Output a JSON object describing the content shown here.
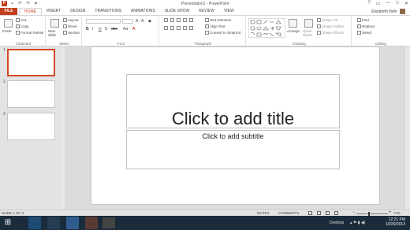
{
  "window": {
    "title": "Presentation1 - PowerPoint",
    "controls": [
      "?",
      "▭",
      "—",
      "□",
      "✕"
    ]
  },
  "qat": {
    "app": "P",
    "save": "▪",
    "undo": "↶",
    "redo": "↷",
    "more": "▾"
  },
  "tabs": {
    "file": "FILE",
    "items": [
      "HOME",
      "INSERT",
      "DESIGN",
      "TRANSITIONS",
      "ANIMATIONS",
      "SLIDE SHOW",
      "REVIEW",
      "VIEW"
    ],
    "active": "HOME"
  },
  "user": {
    "name": "Elizabeth Nohr"
  },
  "ribbon": {
    "clipboard": {
      "label": "Clipboard",
      "paste": "Paste",
      "cut": "Cut",
      "copy": "Copy",
      "format_painter": "Format Painter"
    },
    "slides": {
      "label": "Slides",
      "new_slide": "New Slide",
      "layout": "Layout",
      "reset": "Reset",
      "section": "Section"
    },
    "font": {
      "label": "Font",
      "bold": "B",
      "italic": "I",
      "underline": "U",
      "shadow": "S",
      "strike": "abc",
      "case": "Aa",
      "color": "A"
    },
    "paragraph": {
      "label": "Paragraph",
      "text_direction": "Text Direction",
      "align_text": "Align Text",
      "smartart": "Convert to SmartArt"
    },
    "drawing": {
      "label": "Drawing",
      "arrange": "Arrange",
      "quick_styles": "Quick Styles",
      "shape_fill": "Shape Fill",
      "shape_outline": "Shape Outline",
      "shape_effects": "Shape Effects"
    },
    "editing": {
      "label": "Editing",
      "find": "Find",
      "replace": "Replace",
      "select": "Select"
    }
  },
  "slides": [
    {
      "num": "1"
    },
    {
      "num": "2"
    },
    {
      "num": "3"
    }
  ],
  "slide": {
    "title_placeholder": "Click to add title",
    "subtitle_placeholder": "Click to add subtitle"
  },
  "status": {
    "slide_info": "SLIDE 1 OF 3",
    "notes": "NOTES",
    "comments": "COMMENTS",
    "zoom_minus": "−",
    "zoom_plus": "+",
    "zoom": "74%"
  },
  "taskbar": {
    "start": "⊞",
    "desktop": "Desktop",
    "tray": "▴ ⚑ ▮ ◀)",
    "time": "12:21 PM",
    "date": "10/29/2013"
  },
  "colors": {
    "accent": "#c43e1c",
    "selected_thumb": "#d24726",
    "taskbar": "#1a2b3c"
  }
}
